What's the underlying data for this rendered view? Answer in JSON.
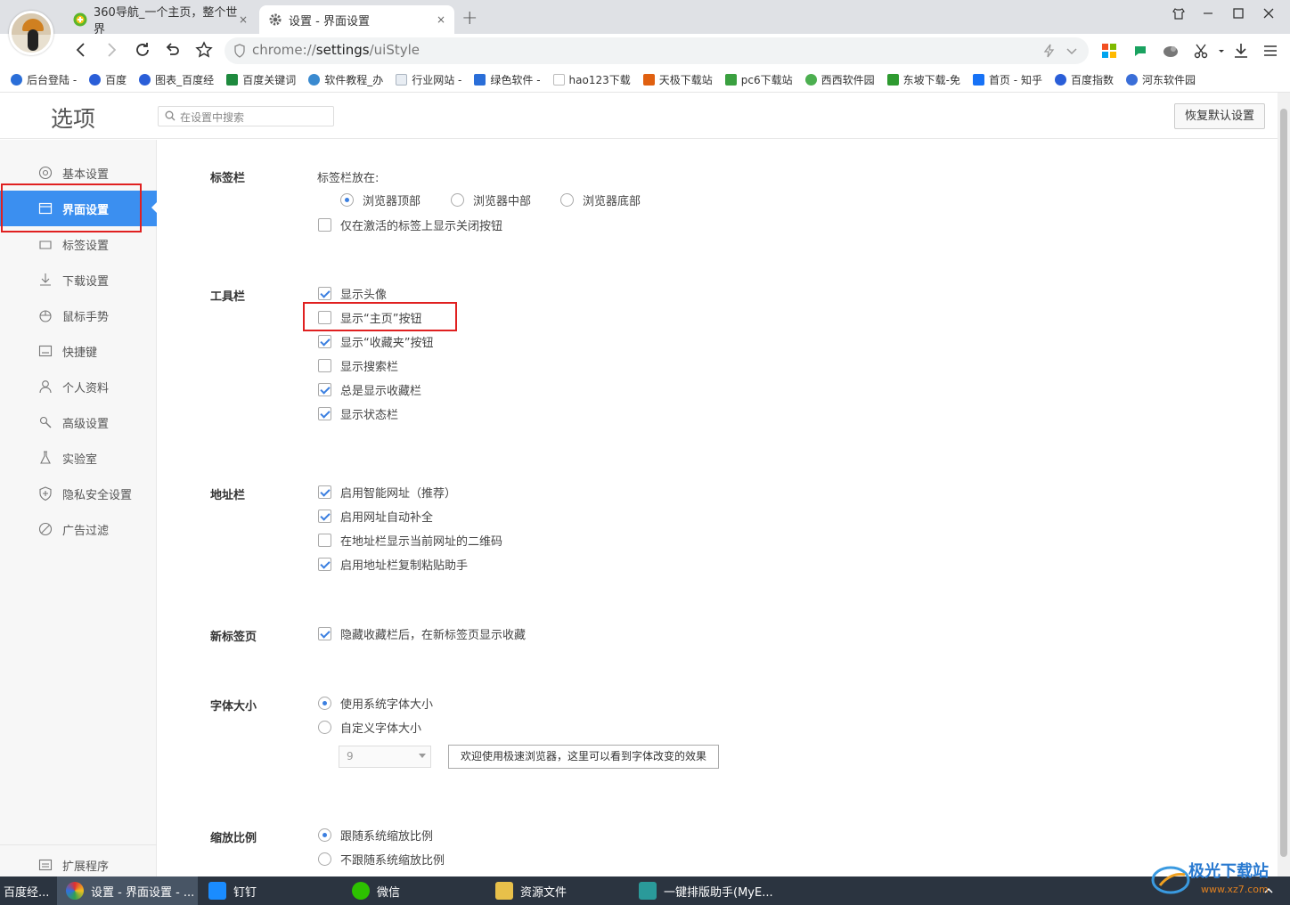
{
  "tabs": [
    {
      "title": "360导航_一个主页，整个世界",
      "close": "×"
    },
    {
      "title": "设置 - 界面设置",
      "close": "×"
    }
  ],
  "new_tab": "+",
  "address": {
    "scheme": "chrome://",
    "host": "settings",
    "path": "/uiStyle"
  },
  "bookmarks": [
    {
      "label": "后台登陆 -",
      "color": "#2a6ed8"
    },
    {
      "label": "百度",
      "color": "#2a5ed8"
    },
    {
      "label": "图表_百度经",
      "color": "#2a5ed8"
    },
    {
      "label": "百度关键词",
      "color": "#1e8a3e"
    },
    {
      "label": "软件教程_办",
      "color": "#3a8ad0"
    },
    {
      "label": "行业网站 -",
      "color": "#aab4c0"
    },
    {
      "label": "绿色软件 -",
      "color": "#2a6ed8"
    },
    {
      "label": "hao123下载",
      "color": "#bbbbbb"
    },
    {
      "label": "天极下载站",
      "color": "#e06010"
    },
    {
      "label": "pc6下载站",
      "color": "#3aa040"
    },
    {
      "label": "西西软件园",
      "color": "#4caf50"
    },
    {
      "label": "东坡下载-免",
      "color": "#2e9a30"
    },
    {
      "label": "首页 - 知乎",
      "color": "#1772f6"
    },
    {
      "label": "百度指数",
      "color": "#2a5ed8"
    },
    {
      "label": "河东软件园",
      "color": "#3a6ed8"
    }
  ],
  "settings": {
    "page_title": "选项",
    "search_placeholder": "在设置中搜索",
    "reset_button": "恢复默认设置"
  },
  "sidebar": {
    "items": [
      {
        "label": "基本设置",
        "icon": "settings-icon"
      },
      {
        "label": "界面设置",
        "icon": "window-icon"
      },
      {
        "label": "标签设置",
        "icon": "tab-icon"
      },
      {
        "label": "下载设置",
        "icon": "download-icon"
      },
      {
        "label": "鼠标手势",
        "icon": "mouse-icon"
      },
      {
        "label": "快捷键",
        "icon": "keyboard-icon"
      },
      {
        "label": "个人资料",
        "icon": "user-icon"
      },
      {
        "label": "高级设置",
        "icon": "advanced-icon"
      },
      {
        "label": "实验室",
        "icon": "flask-icon"
      },
      {
        "label": "隐私安全设置",
        "icon": "shield-icon"
      },
      {
        "label": "广告过滤",
        "icon": "block-icon"
      }
    ],
    "extensions": "扩展程序",
    "active_index": 1
  },
  "sections": {
    "tabbar": {
      "label": "标签栏",
      "position_label": "标签栏放在:",
      "positions": [
        "浏览器顶部",
        "浏览器中部",
        "浏览器底部"
      ],
      "position_selected": 0,
      "close_on_active": {
        "label": "仅在激活的标签上显示关闭按钮",
        "checked": false
      }
    },
    "toolbar": {
      "label": "工具栏",
      "options": [
        {
          "label": "显示头像",
          "checked": true
        },
        {
          "label": "显示“主页”按钮",
          "checked": false
        },
        {
          "label": "显示“收藏夹”按钮",
          "checked": true
        },
        {
          "label": "显示搜索栏",
          "checked": false
        },
        {
          "label": "总是显示收藏栏",
          "checked": true
        },
        {
          "label": "显示状态栏",
          "checked": true
        }
      ]
    },
    "addressbar": {
      "label": "地址栏",
      "options": [
        {
          "label": "启用智能网址（推荐）",
          "checked": true
        },
        {
          "label": "启用网址自动补全",
          "checked": true
        },
        {
          "label": "在地址栏显示当前网址的二维码",
          "checked": false
        },
        {
          "label": "启用地址栏复制粘贴助手",
          "checked": true
        }
      ]
    },
    "newtab": {
      "label": "新标签页",
      "option": {
        "label": "隐藏收藏栏后，在新标签页显示收藏",
        "checked": true
      }
    },
    "fontsize": {
      "label": "字体大小",
      "options": [
        "使用系统字体大小",
        "自定义字体大小"
      ],
      "selected": 0,
      "size_value": "9",
      "preview": "欢迎使用极速浏览器，这里可以看到字体改变的效果"
    },
    "zoom": {
      "label": "缩放比例",
      "options": [
        "跟随系统缩放比例",
        "不跟随系统缩放比例"
      ],
      "selected": 0
    }
  },
  "taskbar": [
    {
      "label": "百度经...",
      "color": "#2a5ed8"
    },
    {
      "label": "设置 - 界面设置 - ...",
      "color": "#e0a020"
    },
    {
      "label": "钉钉",
      "color": "#1a8cff"
    },
    {
      "label": "微信",
      "color": "#2dc100"
    },
    {
      "label": "资源文件",
      "color": "#e8c04a"
    },
    {
      "label": "一键排版助手(MyE...",
      "color": "#2a9a9a"
    }
  ],
  "watermark": {
    "text": "极光下载站",
    "url": "www.xz7.com"
  },
  "colors": {
    "accent": "#3b8ff0",
    "highlight_box": "#e02020",
    "check": "#3b7fe0"
  }
}
